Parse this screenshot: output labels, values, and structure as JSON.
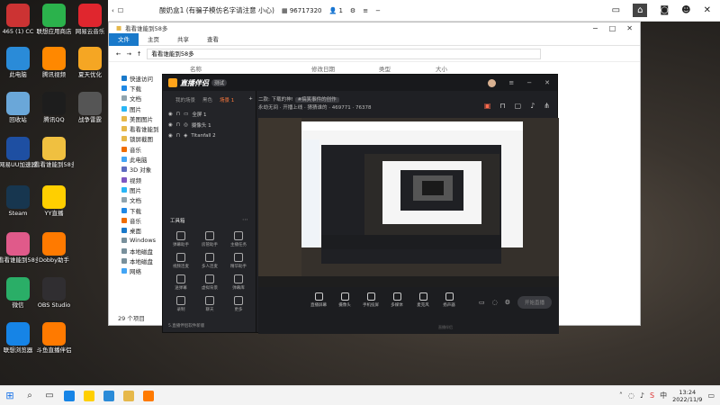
{
  "desktop": {
    "icons": [
      {
        "label": "465 (1) CC",
        "color": "#c33"
      },
      {
        "label": "联想应用商店",
        "color": "#2bb24c"
      },
      {
        "label": "网易云音乐",
        "color": "#e0262e"
      },
      {
        "label": "此电脑",
        "color": "#2a8bd8"
      },
      {
        "label": "腾讯视频",
        "color": "#ff8800"
      },
      {
        "label": "夏天优化",
        "color": "#f5a623"
      },
      {
        "label": "回收站",
        "color": "#6aa7d9"
      },
      {
        "label": "腾讯QQ",
        "color": "#1d1d1d"
      },
      {
        "label": "战争雷霆",
        "color": "#555"
      },
      {
        "label": "网易UU加速器",
        "color": "#1e4fa2"
      },
      {
        "label": "看看谁能到58多",
        "color": "#f0c040"
      },
      {
        "label": "Steam",
        "color": "#17364f"
      },
      {
        "label": "YY直播",
        "color": "#ffcf00"
      },
      {
        "label": "看看谁能到58多",
        "color": "#e05a8a"
      },
      {
        "label": "Dobby助手",
        "color": "#ff7a00"
      },
      {
        "label": "微信",
        "color": "#2aae67"
      },
      {
        "label": "OBS Studio",
        "color": "#302e31"
      },
      {
        "label": "联想浏览器",
        "color": "#1684e6"
      },
      {
        "label": "斗鱼直播伴侣",
        "color": "#ff7a00"
      }
    ]
  },
  "topbar": {
    "title": "酸奶盒1 (有骗子模仿名字请注意 小心)",
    "viewers": "96717320",
    "count": "1",
    "icons": [
      "monitor-icon",
      "home-icon",
      "gamepad-icon",
      "user-icon",
      "close-icon"
    ]
  },
  "explorer": {
    "title": "看看谁能到58多",
    "tabs": [
      "文件",
      "主页",
      "共享",
      "查看"
    ],
    "path": "看看谁能到58多",
    "columns": [
      "名称",
      "修改日期",
      "类型",
      "大小"
    ],
    "sidebar": [
      "快速访问",
      "下载",
      "文档",
      "图片",
      "美图图片",
      "看看谁能到",
      "锁屏截图",
      "音乐",
      "此电脑",
      "3D 对象",
      "视频",
      "图片",
      "文档",
      "下载",
      "音乐",
      "桌面",
      "Windows",
      "本地磁盘",
      "本地磁盘",
      "网络"
    ],
    "status": "29 个项目"
  },
  "live": {
    "app_name": "直播伴侣",
    "version": "测试",
    "tabs": [
      "我的场景",
      "黑色",
      "场景 1"
    ],
    "sources": [
      "全屏 1",
      "摄像头 1",
      "Titanfall 2"
    ],
    "info_line1": "二款: 下载的神!",
    "info_tag": "#搞笑事件的创作",
    "info_line2": "永劫无间 · 开播上线 · 猜猜谁的 · 469771 · 76378",
    "tools_title": "工具箱",
    "tools": [
      "弹幕助手",
      "房管助手",
      "主播任务",
      "视频连麦",
      "多人连麦",
      "精华助手",
      "送弹幕",
      "虚拟背景",
      "弹幕库",
      "录制",
      "聊天",
      "更多"
    ],
    "footer": "5.直播伴侣软件新版",
    "controls": [
      "直播屏幕",
      "摄像头",
      "手机投屏",
      "多媒体",
      "麦克风",
      "扬声器"
    ],
    "start_label": "开始直播",
    "bottom_text": "直播伴侣"
  },
  "taskbar": {
    "time": "13:24",
    "date": "2022/11/9"
  }
}
